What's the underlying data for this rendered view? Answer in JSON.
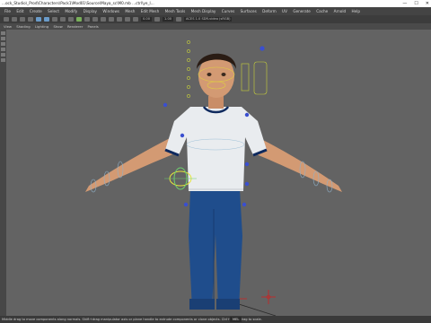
{
  "window": {
    "title": "...ock_Studio\\_Prod\\Characters\\Pack1\\Mod01\\Source\\Maya_sc\\M0.mb   ...ctrl\\ye_l...",
    "minimize": "—",
    "maximize": "☐",
    "close": "✕"
  },
  "menubar": [
    "File",
    "Edit",
    "Create",
    "Select",
    "Modify",
    "Display",
    "Windows",
    "Mesh",
    "Edit Mesh",
    "Mesh Tools",
    "Mesh Display",
    "Curves",
    "Surfaces",
    "Deform",
    "UV",
    "Generate",
    "Cache",
    "Arnold",
    "Help"
  ],
  "toolbar": {
    "field_a": "0.00",
    "field_b": "1.00",
    "color_space": "ACES 1.0 SDR-video (sRGB)"
  },
  "panel_menu": [
    "View",
    "Shading",
    "Lighting",
    "Show",
    "Renderer",
    "Panels"
  ],
  "status": {
    "message": "Middle drag to move components along normals. Shift+drag manipulator axis or plane handle to extrude components or clone objects. Ctrl+Shift+drag to scale.",
    "command_label": "MEL"
  }
}
